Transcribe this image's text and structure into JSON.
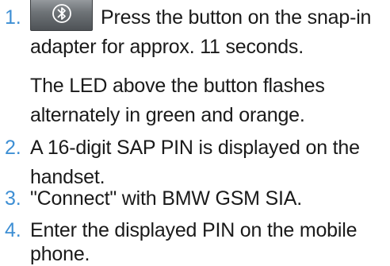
{
  "steps": [
    {
      "number": "1.",
      "icon": "bluetooth-icon",
      "text": "Press the button on the snap-in adapter for approx. 11 seconds.",
      "note": "The LED above the button flashes alternately in green and orange."
    },
    {
      "number": "2.",
      "text": "A 16-digit SAP PIN is displayed on the handset."
    },
    {
      "number": "3.",
      "text": "\"Connect\" with BMW GSM SIA."
    },
    {
      "number": "4.",
      "text": "Enter the displayed PIN on the mobile phone."
    }
  ],
  "colors": {
    "step_number": "#3e8fd4",
    "text": "#1a1a1a",
    "button_dark": "#4e5256",
    "button_light": "#9fa3a7"
  }
}
